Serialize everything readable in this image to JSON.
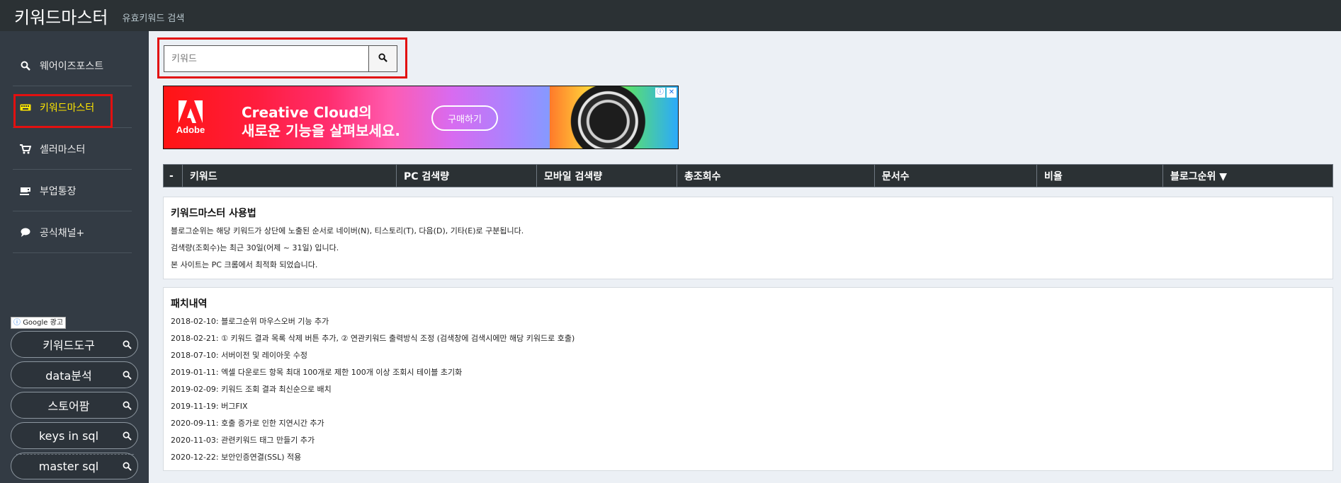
{
  "header": {
    "title": "키워드마스터",
    "subtitle": "유효키워드 검색"
  },
  "sidebar": {
    "items": [
      {
        "label": "웨어이즈포스트",
        "icon": "search-icon"
      },
      {
        "label": "키워드마스터",
        "icon": "keyboard-icon",
        "active": true
      },
      {
        "label": "셀러마스터",
        "icon": "cart-icon"
      },
      {
        "label": "부업통장",
        "icon": "coffee-icon"
      },
      {
        "label": "공식채널+",
        "icon": "chat-icon"
      }
    ],
    "ad_label": "Google 광고",
    "ad_label_info": "ⓘ",
    "tools": [
      {
        "label": "키워드도구"
      },
      {
        "label": "data분석"
      },
      {
        "label": "스토어팜"
      },
      {
        "label": "keys in sql"
      },
      {
        "label": "master sql"
      }
    ]
  },
  "search": {
    "placeholder": "키워드",
    "value": ""
  },
  "ad": {
    "brand": "Adobe",
    "headline_1": "Creative Cloud의",
    "headline_2": "새로운 기능을 살펴보세요.",
    "cta": "구매하기",
    "info": "ⓘ",
    "close": "✕"
  },
  "table": {
    "columns": [
      "-",
      "키워드",
      "PC 검색량",
      "모바일 검색량",
      "총조회수",
      "문서수",
      "비율",
      "블로그순위 ▼"
    ]
  },
  "usage": {
    "title": "키워드마스터 사용법",
    "lines": [
      "블로그순위는 해당 키워드가 상단에 노출된 순서로 네이버(N), 티스토리(T), 다음(D), 기타(E)로 구분됩니다.",
      "검색량(조회수)는 최근 30일(어제 ~ 31일) 입니다.",
      "본 사이트는 PC 크롬에서 최적화 되었습니다."
    ]
  },
  "patch": {
    "title": "패치내역",
    "lines": [
      "2018-02-10: 블로그순위 마우스오버 기능 추가",
      "2018-02-21: ① 키워드 결과 목록 삭제 버튼 추가, ② 연관키워드 출력방식 조정 (검색창에 검색시에만 해당 키워드로 호출)",
      "2018-07-10: 서버이전 및 레이아웃 수정",
      "2019-01-11: 엑셀 다운로드 항목 최대 100개로 제한 100개 이상 조회시 테이블 초기화",
      "2019-02-09: 키워드 조회 결과 최신순으로 배치",
      "2019-11-19: 버그FIX",
      "2020-09-11: 호출 증가로 인한 지연시간 추가",
      "2020-11-03: 관련키워드 태그 만들기 추가",
      "2020-12-22: 보안인증연결(SSL) 적용"
    ]
  },
  "colors": {
    "header_bg": "#2b3134",
    "sidebar_bg": "#333b44",
    "active_text": "#ffe600",
    "highlight_border": "#e21010",
    "main_bg": "#ecf0f5"
  }
}
